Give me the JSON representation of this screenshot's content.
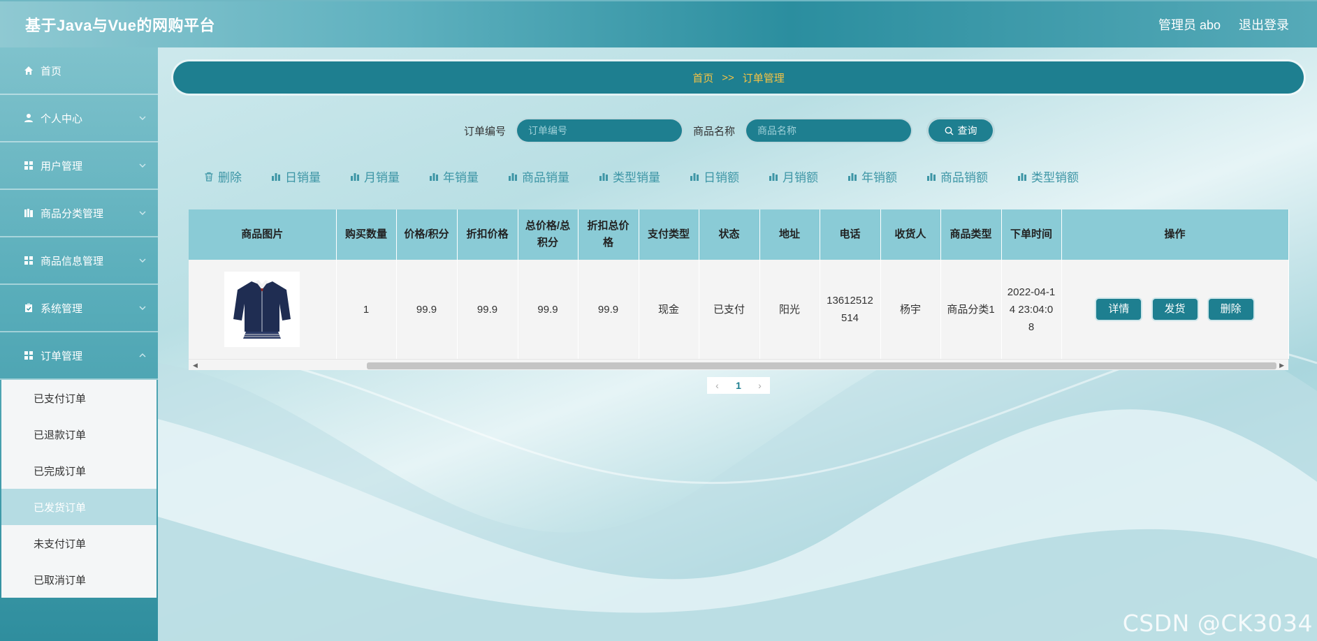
{
  "header": {
    "title": "基于Java与Vue的网购平台",
    "admin_label": "管理员 abo",
    "logout_label": "退出登录"
  },
  "sidebar": {
    "items": [
      {
        "label": "首页",
        "icon": "home-icon"
      },
      {
        "label": "个人中心",
        "icon": "user-icon"
      },
      {
        "label": "用户管理",
        "icon": "grid-icon"
      },
      {
        "label": "商品分类管理",
        "icon": "books-icon"
      },
      {
        "label": "商品信息管理",
        "icon": "grid-icon"
      },
      {
        "label": "系统管理",
        "icon": "clipboard-icon"
      },
      {
        "label": "订单管理",
        "icon": "grid-icon"
      }
    ],
    "submenu": [
      {
        "label": "已支付订单"
      },
      {
        "label": "已退款订单"
      },
      {
        "label": "已完成订单"
      },
      {
        "label": "已发货订单",
        "active": true
      },
      {
        "label": "未支付订单"
      },
      {
        "label": "已取消订单"
      }
    ]
  },
  "breadcrumb": {
    "home": "首页",
    "separator": ">>",
    "current": "订单管理"
  },
  "search": {
    "order_no_label": "订单编号",
    "order_no_placeholder": "订单编号",
    "product_name_label": "商品名称",
    "product_name_placeholder": "商品名称",
    "query_label": "查询"
  },
  "toolbar": {
    "items": [
      {
        "label": "删除",
        "icon": "trash-icon"
      },
      {
        "label": "日销量",
        "icon": "bar-chart-icon"
      },
      {
        "label": "月销量",
        "icon": "bar-chart-icon"
      },
      {
        "label": "年销量",
        "icon": "bar-chart-icon"
      },
      {
        "label": "商品销量",
        "icon": "bar-chart-icon"
      },
      {
        "label": "类型销量",
        "icon": "bar-chart-icon"
      },
      {
        "label": "日销额",
        "icon": "bar-chart-icon"
      },
      {
        "label": "月销额",
        "icon": "bar-chart-icon"
      },
      {
        "label": "年销额",
        "icon": "bar-chart-icon"
      },
      {
        "label": "商品销额",
        "icon": "bar-chart-icon"
      },
      {
        "label": "类型销额",
        "icon": "bar-chart-icon"
      }
    ]
  },
  "table": {
    "columns": [
      "商品图片",
      "购买数量",
      "价格/积分",
      "折扣价格",
      "总价格/总积分",
      "折扣总价格",
      "支付类型",
      "状态",
      "地址",
      "电话",
      "收货人",
      "商品类型",
      "下单时间",
      "操作"
    ],
    "rows": [
      {
        "quantity": "1",
        "price": "99.9",
        "discount_price": "99.9",
        "total_price": "99.9",
        "discount_total": "99.9",
        "pay_type": "现金",
        "status": "已支付",
        "address": "阳光",
        "phone": "13612512514",
        "receiver": "杨宇",
        "category": "商品分类1",
        "order_time": "2022-04-14 23:04:08",
        "actions": {
          "detail": "详情",
          "ship": "发货",
          "delete": "删除"
        }
      }
    ]
  },
  "pagination": {
    "current_page": "1",
    "prev": "‹",
    "next": "›"
  },
  "watermark": "CSDN @CK3034",
  "colors": {
    "primary": "#1e7f90",
    "accent_text": "#f6c344",
    "header_cell": "#8acbd6"
  }
}
